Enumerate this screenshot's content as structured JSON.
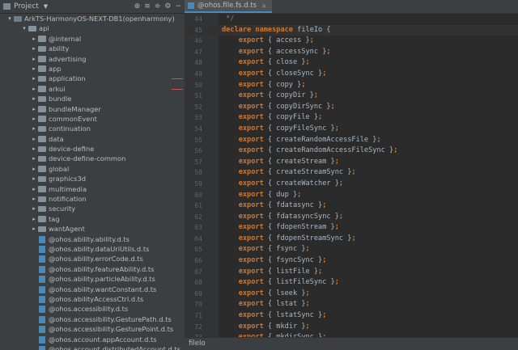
{
  "project_panel": {
    "title": "Project",
    "tools": [
      "⊕",
      "≡",
      "≑",
      "⚙",
      "−"
    ]
  },
  "tree": [
    {
      "label": "ArkTS-HarmonyOS-NEXT-DB1(openharmony)",
      "type": "root",
      "expanded": true
    },
    {
      "label": "api",
      "type": "folder",
      "expanded": true
    },
    {
      "label": "@internal",
      "type": "folder"
    },
    {
      "label": "ability",
      "type": "folder"
    },
    {
      "label": "advertising",
      "type": "folder"
    },
    {
      "label": "app",
      "type": "folder"
    },
    {
      "label": "application",
      "type": "folder",
      "mark": true
    },
    {
      "label": "arkui",
      "type": "folder",
      "mark": true
    },
    {
      "label": "bundle",
      "type": "folder"
    },
    {
      "label": "bundleManager",
      "type": "folder"
    },
    {
      "label": "commonEvent",
      "type": "folder"
    },
    {
      "label": "continuation",
      "type": "folder"
    },
    {
      "label": "data",
      "type": "folder"
    },
    {
      "label": "device-define",
      "type": "folder"
    },
    {
      "label": "device-define-common",
      "type": "folder"
    },
    {
      "label": "global",
      "type": "folder"
    },
    {
      "label": "graphics3d",
      "type": "folder"
    },
    {
      "label": "multimedia",
      "type": "folder"
    },
    {
      "label": "notification",
      "type": "folder"
    },
    {
      "label": "security",
      "type": "folder"
    },
    {
      "label": "tag",
      "type": "folder"
    },
    {
      "label": "wantAgent",
      "type": "folder"
    },
    {
      "label": "@ohos.ability.ability.d.ts",
      "type": "file"
    },
    {
      "label": "@ohos.ability.dataUriUtils.d.ts",
      "type": "file"
    },
    {
      "label": "@ohos.ability.errorCode.d.ts",
      "type": "file"
    },
    {
      "label": "@ohos.ability.featureAbility.d.ts",
      "type": "file"
    },
    {
      "label": "@ohos.ability.particleAbility.d.ts",
      "type": "file"
    },
    {
      "label": "@ohos.ability.wantConstant.d.ts",
      "type": "file"
    },
    {
      "label": "@ohos.abilityAccessCtrl.d.ts",
      "type": "file"
    },
    {
      "label": "@ohos.accessibility.d.ts",
      "type": "file"
    },
    {
      "label": "@ohos.accessibility.GesturePath.d.ts",
      "type": "file"
    },
    {
      "label": "@ohos.accessibility.GesturePoint.d.ts",
      "type": "file"
    },
    {
      "label": "@ohos.account.appAccount.d.ts",
      "type": "file"
    },
    {
      "label": "@ohos.account.distributedAccount.d.ts",
      "type": "file"
    }
  ],
  "editor": {
    "tab_label": "@ohos.file.fs.d.ts",
    "tab_close": "×",
    "breadcrumb": "fileIo",
    "lines": [
      {
        "num": "44",
        "kind": "comment",
        "text": " */"
      },
      {
        "num": "45",
        "kind": "decl",
        "kw1": "declare",
        "kw2": "namespace",
        "name": "fileIo",
        "tail": " {"
      },
      {
        "num": "46",
        "kind": "export",
        "name": "access"
      },
      {
        "num": "47",
        "kind": "export",
        "name": "accessSync"
      },
      {
        "num": "48",
        "kind": "export",
        "name": "close"
      },
      {
        "num": "49",
        "kind": "export",
        "name": "closeSync"
      },
      {
        "num": "50",
        "kind": "export",
        "name": "copy"
      },
      {
        "num": "51",
        "kind": "export",
        "name": "copyDir"
      },
      {
        "num": "52",
        "kind": "export",
        "name": "copyDirSync"
      },
      {
        "num": "53",
        "kind": "export",
        "name": "copyFile"
      },
      {
        "num": "54",
        "kind": "export",
        "name": "copyFileSync"
      },
      {
        "num": "55",
        "kind": "export",
        "name": "createRandomAccessFile"
      },
      {
        "num": "56",
        "kind": "export",
        "name": "createRandomAccessFileSync"
      },
      {
        "num": "57",
        "kind": "export",
        "name": "createStream"
      },
      {
        "num": "58",
        "kind": "export",
        "name": "createStreamSync"
      },
      {
        "num": "59",
        "kind": "export",
        "name": "createWatcher"
      },
      {
        "num": "60",
        "kind": "export",
        "name": "dup"
      },
      {
        "num": "61",
        "kind": "export",
        "name": "fdatasync"
      },
      {
        "num": "62",
        "kind": "export",
        "name": "fdatasyncSync"
      },
      {
        "num": "63",
        "kind": "export",
        "name": "fdopenStream"
      },
      {
        "num": "64",
        "kind": "export",
        "name": "fdopenStreamSync"
      },
      {
        "num": "65",
        "kind": "export",
        "name": "fsync"
      },
      {
        "num": "66",
        "kind": "export",
        "name": "fsyncSync"
      },
      {
        "num": "67",
        "kind": "export",
        "name": "listFile"
      },
      {
        "num": "68",
        "kind": "export",
        "name": "listFileSync"
      },
      {
        "num": "69",
        "kind": "export",
        "name": "lseek"
      },
      {
        "num": "70",
        "kind": "export",
        "name": "lstat"
      },
      {
        "num": "71",
        "kind": "export",
        "name": "lstatSync"
      },
      {
        "num": "72",
        "kind": "export",
        "name": "mkdir"
      },
      {
        "num": "73",
        "kind": "export",
        "name": "mkdirSync"
      }
    ]
  }
}
